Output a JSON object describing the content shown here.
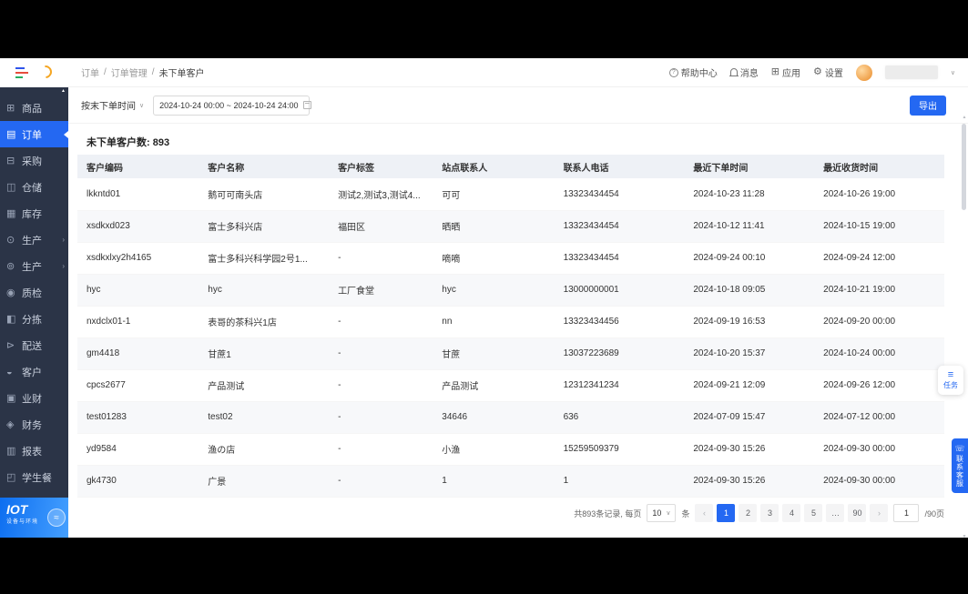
{
  "colors": {
    "accent": "#2468f2",
    "sidebar_bg": "#2b3447",
    "table_header_bg": "#eef1f6",
    "page_bg": "#ffffff"
  },
  "icons": {
    "caret": "∨",
    "arrow_right": "›",
    "up": "▲",
    "down": "▼",
    "iot_badge": "≈",
    "task": "≡",
    "support": "☏"
  },
  "sidebar": {
    "items": [
      {
        "label": "商品",
        "icon": "⊞",
        "active": false,
        "arrow": false
      },
      {
        "label": "订单",
        "icon": "▤",
        "active": true,
        "arrow": false
      },
      {
        "label": "采购",
        "icon": "⊟",
        "active": false,
        "arrow": false
      },
      {
        "label": "仓储",
        "icon": "◫",
        "active": false,
        "arrow": false
      },
      {
        "label": "库存",
        "icon": "▦",
        "active": false,
        "arrow": false
      },
      {
        "label": "生产",
        "icon": "⊙",
        "active": false,
        "arrow": true
      },
      {
        "label": "生产",
        "icon": "⊚",
        "active": false,
        "arrow": true
      },
      {
        "label": "质检",
        "icon": "◉",
        "active": false,
        "arrow": false
      },
      {
        "label": "分拣",
        "icon": "◧",
        "active": false,
        "arrow": false
      },
      {
        "label": "配送",
        "icon": "⊳",
        "active": false,
        "arrow": false
      },
      {
        "label": "客户",
        "icon": "◒",
        "active": false,
        "arrow": false
      },
      {
        "label": "业财",
        "icon": "▣",
        "active": false,
        "arrow": false
      },
      {
        "label": "财务",
        "icon": "◈",
        "active": false,
        "arrow": false
      },
      {
        "label": "报表",
        "icon": "▥",
        "active": false,
        "arrow": false
      },
      {
        "label": "学生餐",
        "icon": "◰",
        "active": false,
        "arrow": false
      }
    ],
    "iot": {
      "title": "IOT",
      "subtitle": "设备与环境"
    }
  },
  "header": {
    "breadcrumb": [
      "订单",
      "订单管理",
      "未下单客户"
    ],
    "separator": "/",
    "actions": [
      {
        "label": "帮助中心",
        "icon": "help",
        "glyph": "?"
      },
      {
        "label": "消息",
        "icon": "bell",
        "glyph": ""
      },
      {
        "label": "应用",
        "icon": "apps",
        "glyph": "⊞"
      },
      {
        "label": "设置",
        "icon": "gear",
        "glyph": "⚙"
      }
    ]
  },
  "filter": {
    "label": "按末下单时间",
    "range": "2024-10-24 00:00 ~ 2024-10-24 24:00",
    "export_label": "导出"
  },
  "summary": {
    "label": "未下单客户数:",
    "value": "893"
  },
  "table": {
    "headers": [
      "客户编码",
      "客户名称",
      "客户标签",
      "站点联系人",
      "联系人电话",
      "最近下单时间",
      "最近收货时间"
    ],
    "rows": [
      [
        "lkkntd01",
        "鹅可可南头店",
        "测试2,测试3,测试4...",
        "可可",
        "13323434454",
        "2024-10-23 11:28",
        "2024-10-26 19:00"
      ],
      [
        "xsdkxd023",
        "富士多科兴店",
        "福田区",
        "晒晒",
        "13323434454",
        "2024-10-12 11:41",
        "2024-10-15 19:00"
      ],
      [
        "xsdkxlxy2h4165",
        "富士多科兴科学园2号1...",
        "-",
        "嘀嘀",
        "13323434454",
        "2024-09-24 00:10",
        "2024-09-24 12:00"
      ],
      [
        "hyc",
        "hyc",
        "工厂食堂",
        "hyc",
        "13000000001",
        "2024-10-18 09:05",
        "2024-10-21 19:00"
      ],
      [
        "nxdclx01-1",
        "表哥的茶科兴1店",
        "-",
        "nn",
        "13323434456",
        "2024-09-19 16:53",
        "2024-09-20 00:00"
      ],
      [
        "gm4418",
        "甘蔗1",
        "-",
        "甘蔗",
        "13037223689",
        "2024-10-20 15:37",
        "2024-10-24 00:00"
      ],
      [
        "cpcs2677",
        "产品测试",
        "-",
        "产品测试",
        "12312341234",
        "2024-09-21 12:09",
        "2024-09-26 12:00"
      ],
      [
        "test01283",
        "test02",
        "-",
        "34646",
        "636",
        "2024-07-09 15:47",
        "2024-07-12 00:00"
      ],
      [
        "yd9584",
        "渔の店",
        "-",
        "小渔",
        "15259509379",
        "2024-09-30 15:26",
        "2024-09-30 00:00"
      ],
      [
        "gk4730",
        "广景",
        "-",
        "1",
        "1",
        "2024-09-30 15:26",
        "2024-09-30 00:00"
      ]
    ]
  },
  "pagination": {
    "total_text": "共893条记录, 每页",
    "page_size": "10",
    "unit_label": "条",
    "prev": "‹",
    "next": "›",
    "pages": [
      "1",
      "2",
      "3",
      "4",
      "5",
      "…",
      "90"
    ],
    "current": "1",
    "jumper_value": "1",
    "jumper_suffix": "/90页"
  },
  "floating": {
    "task": "任务",
    "support": "联系客服"
  }
}
